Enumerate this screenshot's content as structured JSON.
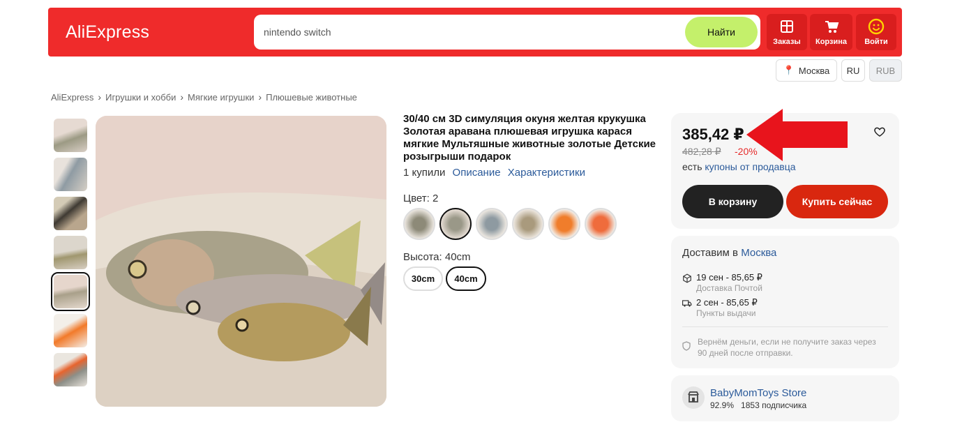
{
  "header": {
    "logo": "AliExpress",
    "search": {
      "value": "nintendo switch",
      "button": "Найти"
    },
    "buttons": [
      {
        "label": "Заказы",
        "icon": "orders-box-icon"
      },
      {
        "label": "Корзина",
        "icon": "cart-icon"
      },
      {
        "label": "Войти",
        "icon": "smiley-icon"
      }
    ],
    "colors": {
      "brand": "#ef2b2b",
      "search_button": "#c4f06b"
    }
  },
  "locale": {
    "city": "Москва",
    "language": "RU",
    "currency": "RUB"
  },
  "breadcrumb": [
    "AliExpress",
    "Игрушки и хобби",
    "Мягкие игрушки",
    "Плюшевые животные"
  ],
  "gallery": {
    "thumbnail_count": 7,
    "selected_index": 4
  },
  "product": {
    "title": "30/40 см 3D симуляция окуня желтая крукушка Золотая аравана плюшевая игрушка карася мягкие Мультяшные животные золотые Детские розыгрыши подарок",
    "sold": "1 купили",
    "links": [
      "Описание",
      "Характеристики"
    ],
    "color_label": "Цвет: 2",
    "color_swatches": 6,
    "selected_color_index": 1,
    "height_label": "Высота: 40cm",
    "sizes": [
      "30cm",
      "40cm"
    ],
    "selected_size": "40cm"
  },
  "price_card": {
    "price": "385,42 ₽",
    "old_price": "482,28 ₽",
    "discount": "-20%",
    "coupons_prefix": "есть",
    "coupons_link": "купоны от продавца",
    "cart_button": "В корзину",
    "buy_button": "Купить сейчас"
  },
  "delivery": {
    "title_prefix": "Доставим в",
    "city": "Москва",
    "options": [
      {
        "line1": "19 сен - 85,65 ₽",
        "line2": "Доставка Почтой",
        "icon": "box-icon"
      },
      {
        "line1": "2 сен - 85,65 ₽",
        "line2": "Пункты выдачи",
        "icon": "truck-icon"
      }
    ],
    "guarantee": "Вернём деньги, если не получите заказ через 90 дней после отправки."
  },
  "store": {
    "name": "BabyMomToys Store",
    "rating": "92.9%",
    "subscribers": "1853 подписчика"
  }
}
